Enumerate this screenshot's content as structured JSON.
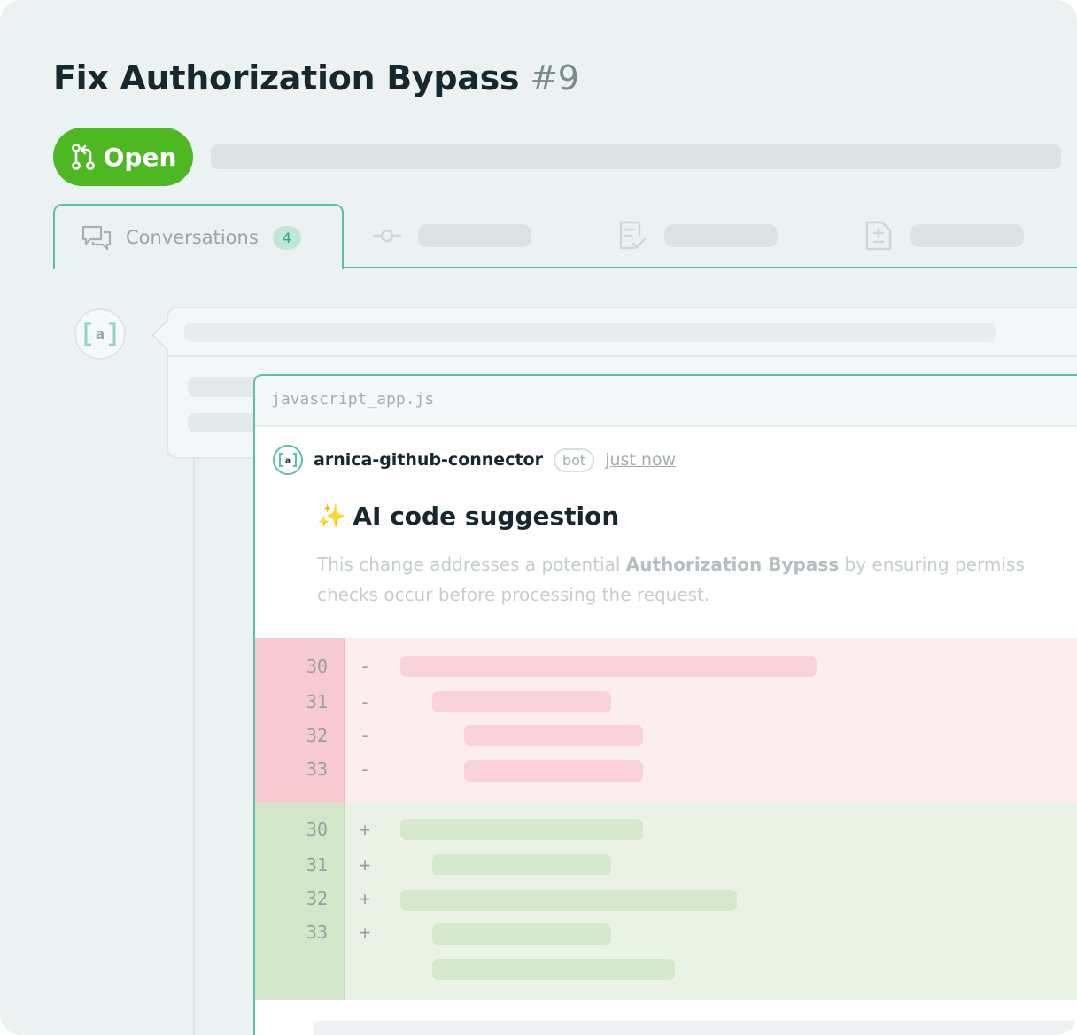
{
  "pr": {
    "title": "Fix Authorization Bypass",
    "number": "#9",
    "status": "Open"
  },
  "tabs": [
    {
      "label": "Conversations",
      "count": "4",
      "icon": "conversations-icon"
    },
    {
      "label": "",
      "icon": "commit-icon"
    },
    {
      "label": "",
      "icon": "checks-icon"
    },
    {
      "label": "",
      "icon": "files-changed-icon"
    }
  ],
  "file": {
    "name": "javascript_app.js"
  },
  "comment": {
    "author": "arnica-github-connector",
    "badge": "bot",
    "time": "just now",
    "title_emoji": "✨",
    "title": "AI code suggestion",
    "body_part1": "This change addresses a potential ",
    "body_bold": "Authorization Bypass",
    "body_part2": " by ensuring permiss",
    "body_line2": "checks occur before processing the request."
  },
  "diff": {
    "removed": [
      {
        "line": "30",
        "sign": "-"
      },
      {
        "line": "31",
        "sign": "-"
      },
      {
        "line": "32",
        "sign": "-"
      },
      {
        "line": "33",
        "sign": "-"
      }
    ],
    "added": [
      {
        "line": "30",
        "sign": "+"
      },
      {
        "line": "31",
        "sign": "+"
      },
      {
        "line": "32",
        "sign": "+"
      },
      {
        "line": "33",
        "sign": "+"
      }
    ]
  },
  "colors": {
    "accent": "#5cc0a8",
    "open": "#4db822",
    "removed": "#f7c9d0",
    "added": "#d2e6c9"
  }
}
